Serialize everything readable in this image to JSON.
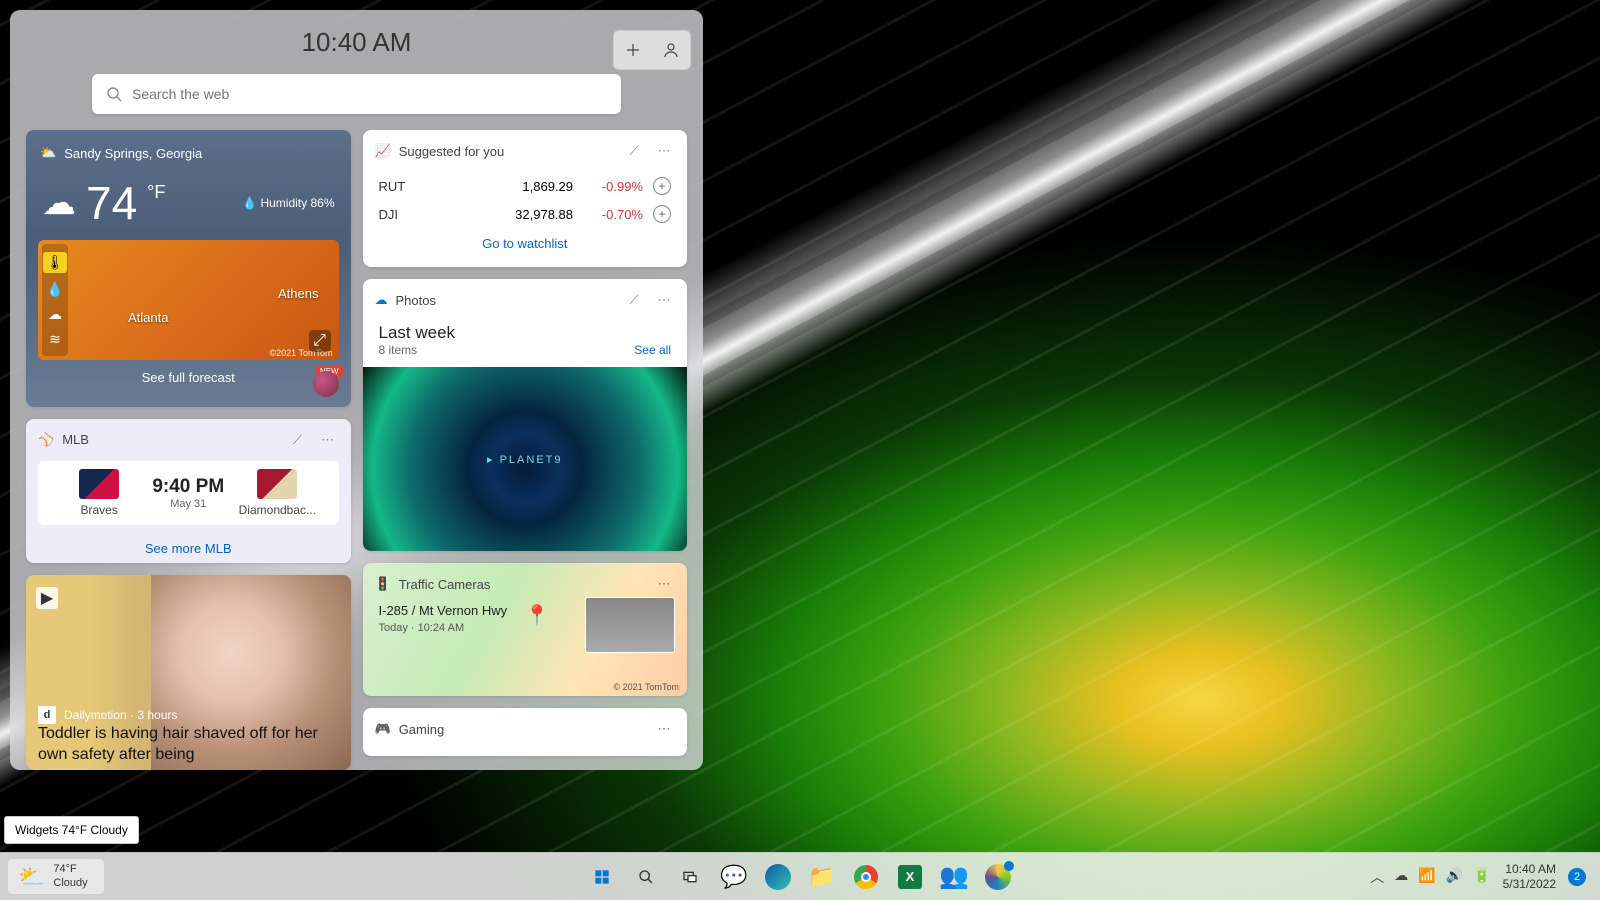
{
  "panel": {
    "time": "10:40 AM",
    "search_placeholder": "Search the web"
  },
  "weather": {
    "location": "Sandy Springs, Georgia",
    "temp": "74",
    "unit": "°F",
    "humidity": "Humidity 86%",
    "city1": "Atlanta",
    "city2": "Athens",
    "map_copy": "©2021 TomTom",
    "forecast_link": "See full forecast",
    "new_badge": "NEW"
  },
  "stocks": {
    "title": "Suggested for you",
    "rows": [
      {
        "sym": "RUT",
        "val": "1,869.29",
        "chg": "-0.99%"
      },
      {
        "sym": "DJI",
        "val": "32,978.88",
        "chg": "-0.70%"
      }
    ],
    "link": "Go to watchlist"
  },
  "photos": {
    "title": "Photos",
    "heading": "Last week",
    "count": "8 items",
    "see_all": "See all",
    "img_text": "▸ PLANET9"
  },
  "mlb": {
    "title": "MLB",
    "team1": "Braves",
    "team2": "Diamondbac...",
    "time": "9:40 PM",
    "date": "May 31",
    "link": "See more MLB"
  },
  "traffic": {
    "title": "Traffic Cameras",
    "loc": "I-285 / Mt Vernon Hwy",
    "time": "Today · 10:24 AM",
    "copy": "© 2021 TomTom"
  },
  "gaming": {
    "title": "Gaming"
  },
  "news": {
    "source_badge": "d",
    "source": "Dailymotion · 3 hours",
    "headline": "Toddler is having hair shaved off for her own safety after being"
  },
  "tooltip": "Widgets 74°F Cloudy",
  "taskbar": {
    "temp": "74°F",
    "cond": "Cloudy",
    "time": "10:40 AM",
    "date": "5/31/2022",
    "notif": "2"
  }
}
